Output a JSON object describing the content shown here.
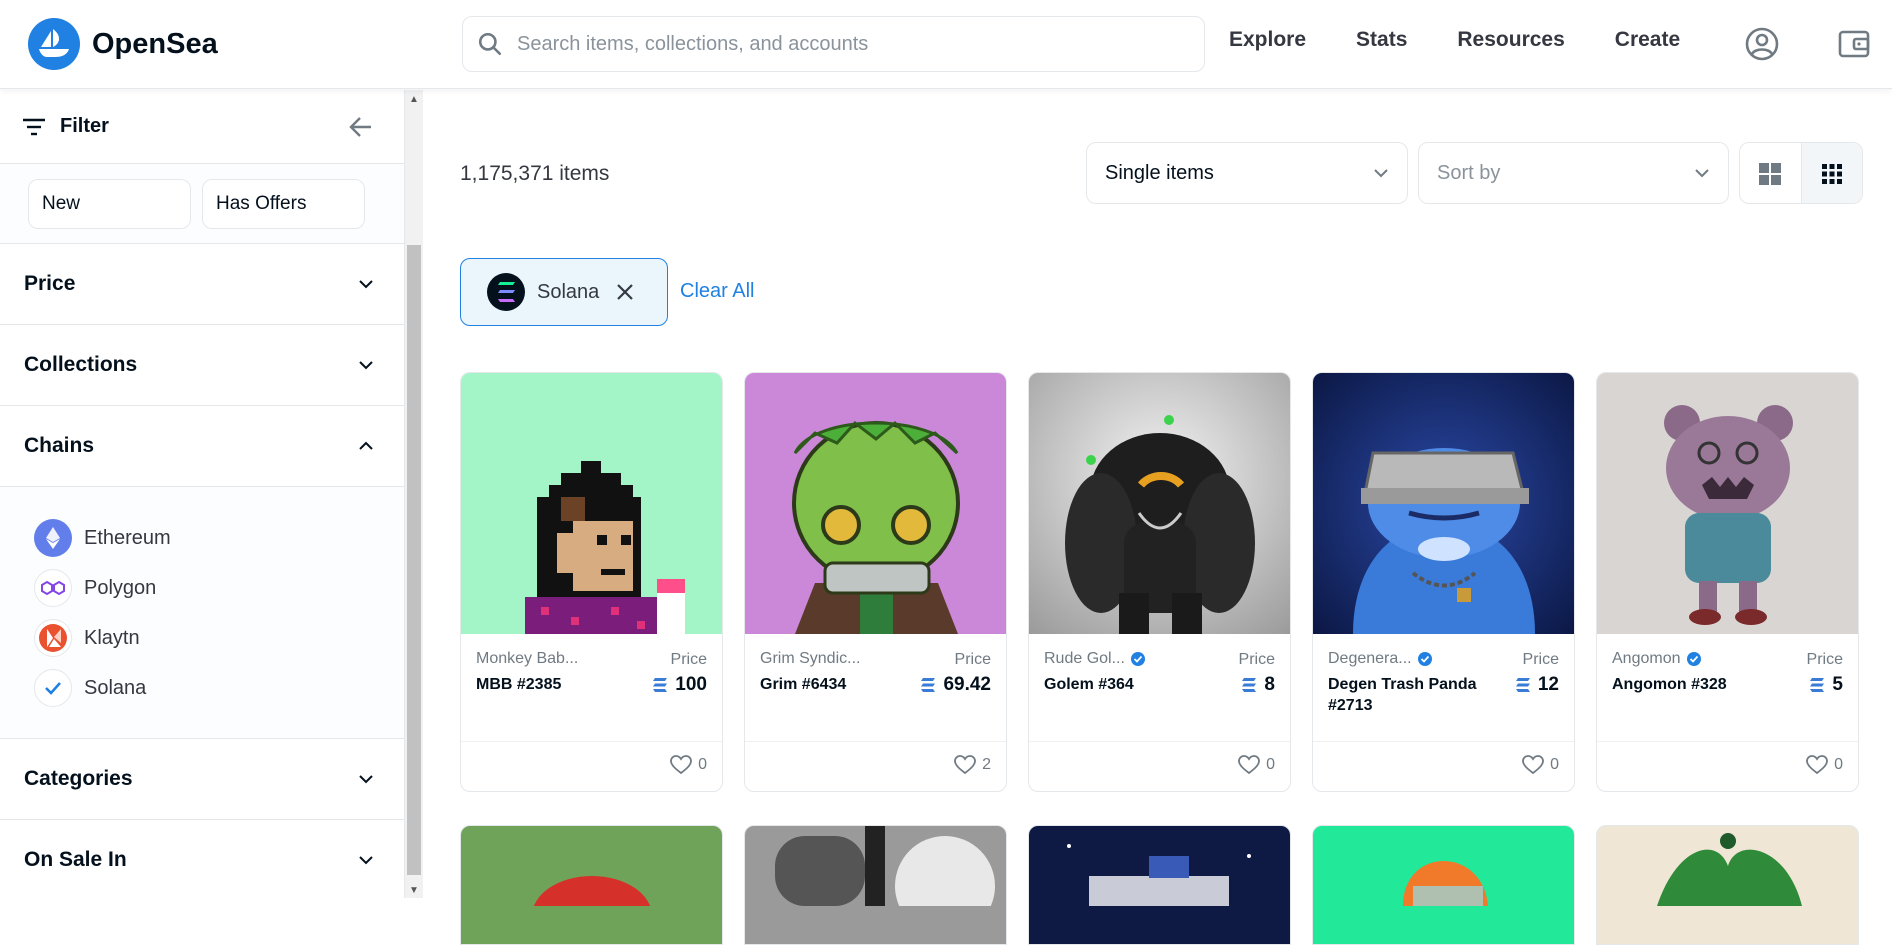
{
  "brand": {
    "name": "OpenSea",
    "accent": "#2081e2"
  },
  "search": {
    "placeholder": "Search items, collections, and accounts"
  },
  "nav": {
    "explore": "Explore",
    "stats": "Stats",
    "resources": "Resources",
    "create": "Create"
  },
  "sidebar": {
    "filter_label": "Filter",
    "status": {
      "new": "New",
      "has_offers": "Has Offers"
    },
    "sections": {
      "price": "Price",
      "collections": "Collections",
      "chains": "Chains",
      "categories": "Categories",
      "on_sale_in": "On Sale In"
    },
    "chains": [
      {
        "label": "Ethereum",
        "icon": "ethereum-icon",
        "selected": false
      },
      {
        "label": "Polygon",
        "icon": "polygon-icon",
        "selected": false
      },
      {
        "label": "Klaytn",
        "icon": "klaytn-icon",
        "selected": false
      },
      {
        "label": "Solana",
        "icon": "check-icon",
        "selected": true
      }
    ]
  },
  "main": {
    "item_count": "1,175,371 items",
    "type_select": "Single items",
    "sort_placeholder": "Sort by",
    "active_filter": "Solana",
    "clear_all": "Clear All"
  },
  "cards": [
    {
      "collection": "Monkey Bab...",
      "verified": false,
      "name": "MBB #2385",
      "price_label": "Price",
      "price": "100",
      "likes": "0"
    },
    {
      "collection": "Grim Syndic...",
      "verified": false,
      "name": "Grim #6434",
      "price_label": "Price",
      "price": "69.42",
      "likes": "2"
    },
    {
      "collection": "Rude Gol...",
      "verified": true,
      "name": "Golem #364",
      "price_label": "Price",
      "price": "8",
      "likes": "0"
    },
    {
      "collection": "Degenera...",
      "verified": true,
      "name": "Degen Trash Panda #2713",
      "price_label": "Price",
      "price": "12",
      "likes": "0"
    },
    {
      "collection": "Angomon",
      "verified": true,
      "name": "Angomon #328",
      "price_label": "Price",
      "price": "5",
      "likes": "0"
    }
  ]
}
